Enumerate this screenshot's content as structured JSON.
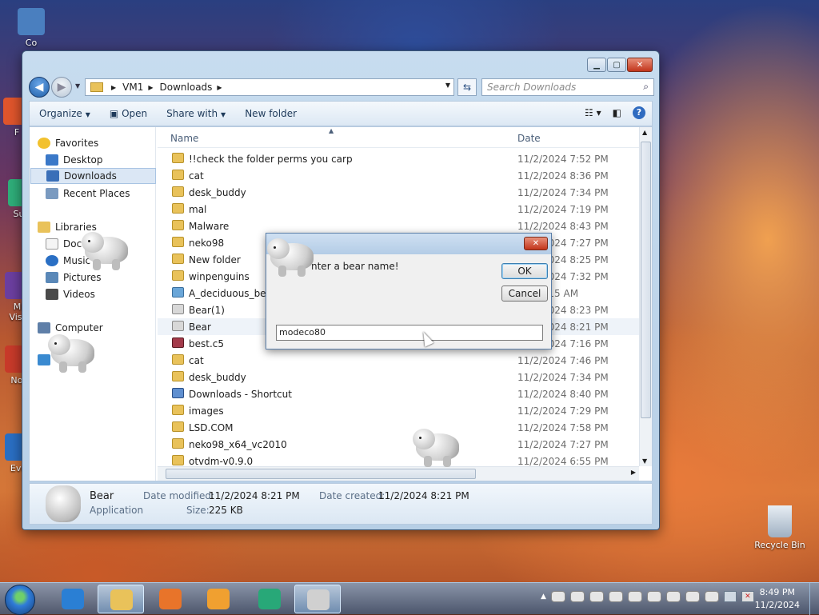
{
  "desktop": {
    "icons": [
      {
        "label": "Co",
        "color": "#4a7fbf"
      },
      {
        "label": "F",
        "color": "#e0552c"
      },
      {
        "label": "Sup",
        "color": "#2fae7a"
      },
      {
        "label": "Mi\nVisu",
        "color": "#6c3fa0"
      },
      {
        "label": "Not",
        "color": "#c83a2a"
      },
      {
        "label": "Eve",
        "color": "#2a6fc4"
      }
    ],
    "recycle_bin": "Recycle Bin"
  },
  "window": {
    "address": {
      "crumbs": [
        "VM1",
        "Downloads"
      ]
    },
    "search_placeholder": "Search Downloads",
    "toolbar": {
      "organize": "Organize",
      "open": "Open",
      "share_with": "Share with",
      "new_folder": "New folder"
    },
    "nav": {
      "favorites": "Favorites",
      "desktop": "Desktop",
      "downloads": "Downloads",
      "recent_places": "Recent Places",
      "libraries": "Libraries",
      "documents": "Doc",
      "music": "Music",
      "pictures": "Pictures",
      "videos": "Videos",
      "computer": "Computer"
    },
    "columns": {
      "name": "Name",
      "date": "Date"
    },
    "files": [
      {
        "name": "!!check the folder perms you carp",
        "date": "11/2/2024 7:52 PM",
        "type": "folder"
      },
      {
        "name": "cat",
        "date": "11/2/2024 8:36 PM",
        "type": "folder"
      },
      {
        "name": "desk_buddy",
        "date": "11/2/2024 7:34 PM",
        "type": "folder"
      },
      {
        "name": "mal",
        "date": "11/2/2024 7:19 PM",
        "type": "folder"
      },
      {
        "name": "Malware",
        "date": "11/2/2024 8:43 PM",
        "type": "folder"
      },
      {
        "name": "neko98",
        "date": "11/2/2024 7:27 PM",
        "type": "folder"
      },
      {
        "name": "New folder",
        "date": "11/2/2024 8:25 PM",
        "type": "folder"
      },
      {
        "name": "winpenguins",
        "date": "11/2/2024 7:32 PM",
        "type": "folder"
      },
      {
        "name": "A_deciduous_beech",
        "date": "22 11:15 AM",
        "type": "img"
      },
      {
        "name": "Bear(1)",
        "date": "11/2/2024 8:23 PM",
        "type": "app"
      },
      {
        "name": "Bear",
        "date": "11/2/2024 8:21 PM",
        "type": "app"
      },
      {
        "name": "best.c5",
        "date": "11/2/2024 7:16 PM",
        "type": "rar"
      },
      {
        "name": "cat",
        "date": "11/2/2024 7:46 PM",
        "type": "folder"
      },
      {
        "name": "desk_buddy",
        "date": "11/2/2024 7:34 PM",
        "type": "folder"
      },
      {
        "name": "Downloads - Shortcut",
        "date": "11/2/2024 8:40 PM",
        "type": "lnk"
      },
      {
        "name": "images",
        "date": "11/2/2024 7:29 PM",
        "type": "folder"
      },
      {
        "name": "LSD.COM",
        "date": "11/2/2024 7:58 PM",
        "type": "folder"
      },
      {
        "name": "neko98_x64_vc2010",
        "date": "11/2/2024 7:27 PM",
        "type": "folder"
      },
      {
        "name": "otvdm-v0.9.0",
        "date": "11/2/2024 6:55 PM",
        "type": "folder"
      }
    ],
    "details": {
      "name": "Bear",
      "type": "Application",
      "date_modified_label": "Date modified:",
      "date_modified": "11/2/2024 8:21 PM",
      "date_created_label": "Date created:",
      "date_created": "11/2/2024 8:21 PM",
      "size_label": "Size:",
      "size": "225 KB"
    }
  },
  "dialog": {
    "prompt": "nter a bear name!",
    "ok": "OK",
    "cancel": "Cancel",
    "input_value": "modeco80"
  },
  "taskbar": {
    "apps": [
      {
        "name": "ie",
        "color": "#2a7fd4"
      },
      {
        "name": "explorer",
        "color": "#e9c25a"
      },
      {
        "name": "firefox",
        "color": "#e8742a"
      },
      {
        "name": "media",
        "color": "#f0a030"
      },
      {
        "name": "greenapp",
        "color": "#28a878"
      },
      {
        "name": "bear",
        "color": "#d0d0d0"
      }
    ],
    "clock": {
      "time": "8:49 PM",
      "date": "11/2/2024"
    }
  }
}
